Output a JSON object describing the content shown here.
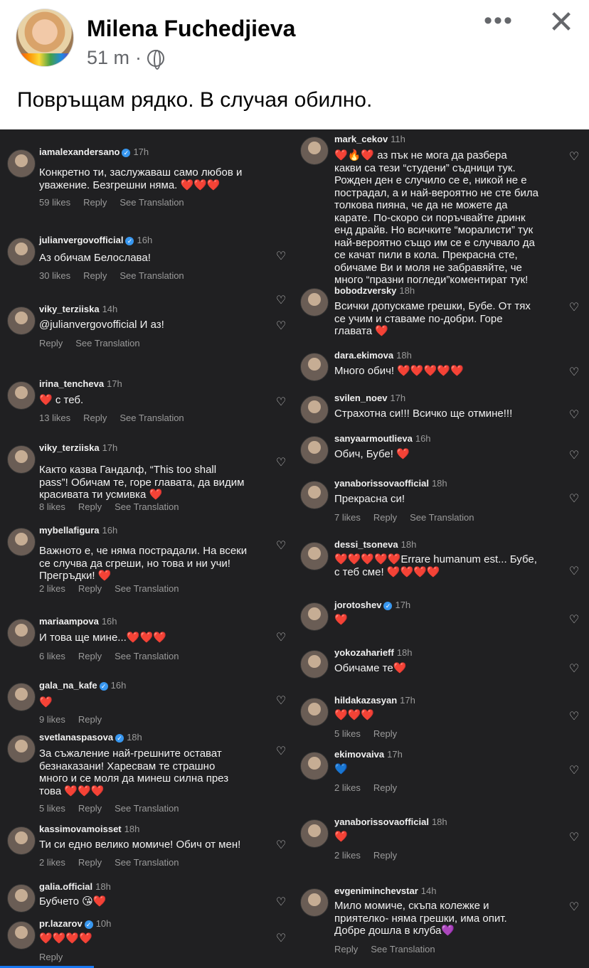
{
  "post": {
    "author": "Milena Fuchedjieva",
    "time": "51 m",
    "separator": "·",
    "more_label": "•••",
    "close_label": "✕",
    "caption": "Повръщам рядко. В случая обилно."
  },
  "colors": {
    "ig_background": "#202022",
    "fb_blue": "#1877f2"
  },
  "left_comments": [
    {
      "user": "iamalexandersano",
      "verified": true,
      "time": "17h",
      "text": "Конкретно ти, заслужаваш само любов и\nуважение. Безгрешни няма. ❤️❤️❤️",
      "actions": [
        "59 likes",
        "Reply",
        "See Translation"
      ]
    },
    {
      "user": "julianvergovofficial",
      "verified": true,
      "time": "16h",
      "text": "Аз обичам Белослава!",
      "actions": [
        "30 likes",
        "Reply",
        "See Translation"
      ]
    },
    {
      "user": "viky_terziiska",
      "verified": false,
      "time": "14h",
      "text": "@julianvergovofficial И аз!",
      "actions": [
        "Reply",
        "See Translation"
      ]
    },
    {
      "user": "irina_tencheva",
      "verified": false,
      "time": "17h",
      "text": "❤️ с теб.",
      "actions": [
        "13 likes",
        "Reply",
        "See Translation"
      ]
    },
    {
      "user": "viky_terziiska",
      "verified": false,
      "time": "17h",
      "text": "Както казва Гандалф, “This too shall\npass”! Обичам те, горе главата, да видим\nкрасивата ти усмивка ❤️",
      "actions": [
        "8 likes",
        "Reply",
        "See Translation"
      ]
    },
    {
      "user": "mybellafigura",
      "verified": false,
      "time": "16h",
      "text": "Важното е, че няма пострадали. На всеки\nсе случва да сгреши, но това и ни учи!\nПрегръдки! ❤️",
      "actions": [
        "2 likes",
        "Reply",
        "See Translation"
      ]
    },
    {
      "user": "mariaampova",
      "verified": false,
      "time": "16h",
      "text": "И това ще мине...❤️❤️❤️",
      "actions": [
        "6 likes",
        "Reply",
        "See Translation"
      ]
    },
    {
      "user": "gala_na_kafe",
      "verified": true,
      "time": "16h",
      "text": "❤️",
      "actions": [
        "9 likes",
        "Reply"
      ]
    },
    {
      "user": "svetlanaspasova",
      "verified": true,
      "time": "18h",
      "text": "За съжаление най-грешните остават\nбезнаказани! Харесвам те страшно\nмного и се моля да минеш силна през\nтова ❤️❤️❤️",
      "actions": [
        "5 likes",
        "Reply",
        "See Translation"
      ]
    },
    {
      "user": "kassimovamoisset",
      "verified": false,
      "time": "18h",
      "text": "Ти си едно велико момиче! Обич от мен!",
      "actions": [
        "2 likes",
        "Reply",
        "See Translation"
      ]
    },
    {
      "user": "galia.official",
      "verified": false,
      "time": "18h",
      "text": "Бубчето 😘❤️",
      "actions": []
    },
    {
      "user": "pr.lazarov",
      "verified": true,
      "time": "10h",
      "text": "❤️❤️❤️❤️",
      "actions": [
        "Reply"
      ]
    }
  ],
  "right_comments": [
    {
      "user": "mark_cekov",
      "verified": false,
      "time": "11h",
      "text": "❤️🔥❤️ аз пък не мога да разбера\nкакви са тези “студени” съдници тук.\nРожден ден е случило се е, никой не е\nпострадал, а и най-вероятно не сте била\nтолкова пияна, че да не можете да\nкарате. По-скоро си поръчвайте дринк\nенд драйв. Но всичките “моралисти” тук\nнай-вероятно също им се е случвало да\nсе качат пили в кола. Прекрасна сте,\nобичаме Ви и моля не забравяйте, че\nмного “празни погледи”коментират тук!",
      "actions": []
    },
    {
      "user": "bobodzversky",
      "verified": false,
      "time": "18h",
      "text": "Всички допускаме грешки, Бубе. От тях\nсе учим и ставаме по-добри. Горе\nглавата ❤️",
      "actions": []
    },
    {
      "user": "dara.ekimova",
      "verified": false,
      "time": "18h",
      "text": "Много обич! ❤️❤️❤️❤️❤️",
      "actions": []
    },
    {
      "user": "svilen_noev",
      "verified": false,
      "time": "17h",
      "text": "Страхотна си!!! Всичко ще отмине!!!",
      "actions": []
    },
    {
      "user": "sanyaarmoutlieva",
      "verified": false,
      "time": "16h",
      "text": "Обич, Бубе! ❤️",
      "actions": []
    },
    {
      "user": "yanaborissovaofficial",
      "verified": false,
      "time": "18h",
      "text": "Прекрасна си!",
      "actions": [
        "7 likes",
        "Reply",
        "See Translation"
      ]
    },
    {
      "user": "dessi_tsoneva",
      "verified": false,
      "time": "18h",
      "text": "❤️❤️❤️❤️❤️Errare humanum est... Бубе,\nс теб сме! ❤️❤️❤️❤️",
      "actions": []
    },
    {
      "user": "jorotoshev",
      "verified": true,
      "time": "17h",
      "text": "❤️",
      "actions": []
    },
    {
      "user": "yokozaharieff",
      "verified": false,
      "time": "18h",
      "text": "Обичаме те❤️",
      "actions": []
    },
    {
      "user": "hildakazasyan",
      "verified": false,
      "time": "17h",
      "text": "❤️❤️❤️",
      "actions": [
        "5 likes",
        "Reply"
      ]
    },
    {
      "user": "ekimovaiva",
      "verified": false,
      "time": "17h",
      "text": "💙",
      "actions": [
        "2 likes",
        "Reply"
      ]
    },
    {
      "user": "yanaborissovaofficial",
      "verified": false,
      "time": "18h",
      "text": "❤️",
      "actions": [
        "2 likes",
        "Reply"
      ]
    },
    {
      "user": "evgeniminchevstar",
      "verified": false,
      "time": "14h",
      "text": "Мило момиче, скъпа колежке и\nприятелко- няма грешки, има опит.\nДобре дошла в клуба💜",
      "actions": [
        "Reply",
        "See Translation"
      ]
    }
  ]
}
